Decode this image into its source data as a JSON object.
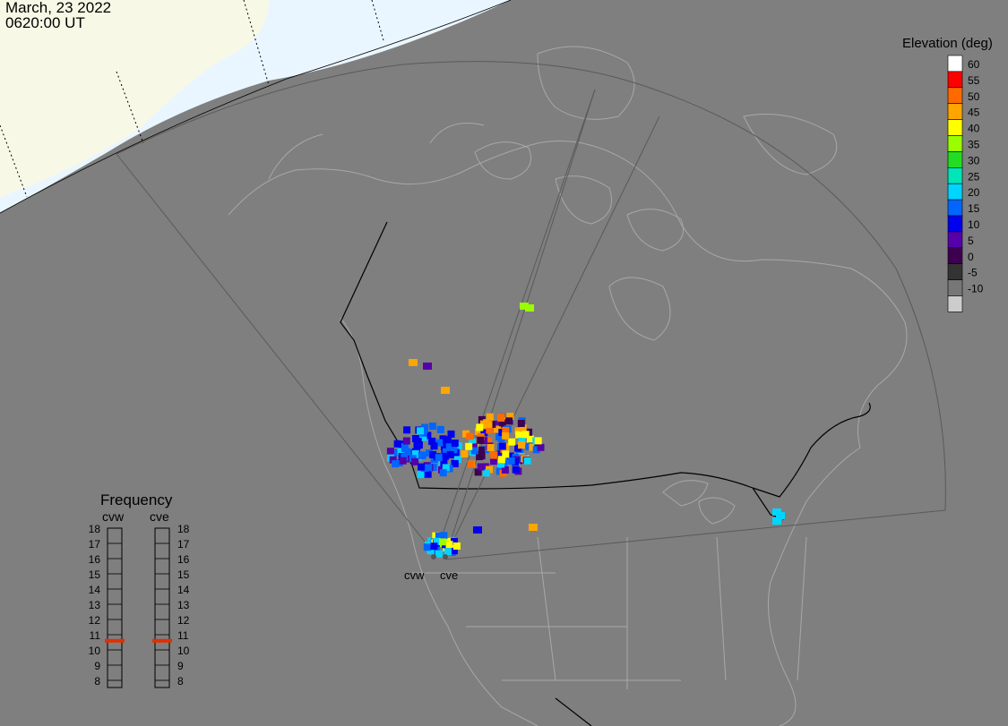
{
  "header": {
    "date": "March, 23 2022",
    "time": "0620:00 UT"
  },
  "colorbar": {
    "title": "Elevation (deg)",
    "ticks": [
      {
        "label": "60",
        "color": "#ffffff"
      },
      {
        "label": "55",
        "color": "#ff0000"
      },
      {
        "label": "50",
        "color": "#ff6a00"
      },
      {
        "label": "45",
        "color": "#ffa500"
      },
      {
        "label": "40",
        "color": "#ffff00"
      },
      {
        "label": "35",
        "color": "#99ff00"
      },
      {
        "label": "30",
        "color": "#22dd22"
      },
      {
        "label": "25",
        "color": "#00e6b8"
      },
      {
        "label": "20",
        "color": "#00d5ff"
      },
      {
        "label": "15",
        "color": "#0066ff"
      },
      {
        "label": "10",
        "color": "#0000ee"
      },
      {
        "label": "5",
        "color": "#5500aa"
      },
      {
        "label": "0",
        "color": "#3d0050"
      },
      {
        "label": "-5",
        "color": "#333333"
      },
      {
        "label": "-10",
        "color": "#777777"
      },
      {
        "label": "",
        "color": "#cccccc"
      }
    ]
  },
  "frequency": {
    "title": "Frequency",
    "radars": [
      "cvw",
      "cve"
    ],
    "levels": [
      "18",
      "17",
      "16",
      "15",
      "14",
      "13",
      "12",
      "11",
      "10",
      "9",
      "8"
    ],
    "indicator_color": "#e03000",
    "current": {
      "cvw": 10.6,
      "cve": 10.6
    }
  },
  "radar_labels": {
    "west": "cvw",
    "east": "cve"
  },
  "colors": {
    "background": "#7f7f7f",
    "land_outline": "#a8a8a8",
    "border": "#000000",
    "fov_line": "#5a5a5a",
    "daylight": "#f8f8e8",
    "sky": "#e8f5ff"
  }
}
